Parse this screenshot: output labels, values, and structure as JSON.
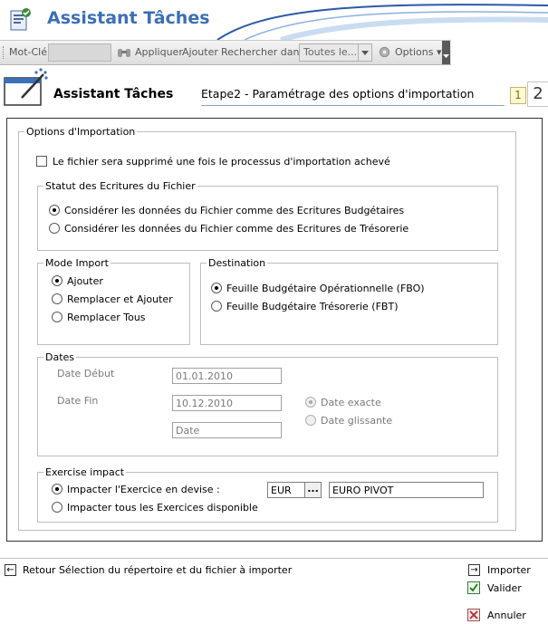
{
  "app": {
    "title": "Assistant Tâches"
  },
  "toolbar": {
    "keyword_label": "Mot-Clé",
    "apply_label": "Appliquer",
    "add_label": "Ajouter",
    "search_in_label": "Rechercher dans",
    "scope_value": "Toutes le...",
    "options_label": "Options"
  },
  "wizard": {
    "title": "Assistant Tâches",
    "step_title": "Etape2 - Paramétrage des options d'importation",
    "step1": "1",
    "step2": "2"
  },
  "import_options": {
    "legend": "Options d'Importation",
    "delete_file_label": "Le fichier sera supprimé une fois le processus d'importation achevé",
    "delete_file_checked": false
  },
  "statut": {
    "legend": "Statut des Ecritures du Fichier",
    "options": [
      "Considérer les données du Fichier comme des Ecritures Budgétaires",
      "Considérer les données du Fichier comme des Ecritures de Trésorerie"
    ],
    "selected_index": 0
  },
  "mode_import": {
    "legend": "Mode Import",
    "options": [
      "Ajouter",
      "Remplacer et Ajouter",
      "Remplacer Tous"
    ],
    "selected_index": 0
  },
  "destination": {
    "legend": "Destination",
    "options": [
      "Feuille Budgétaire Opérationnelle (FBO)",
      "Feuille Budgétaire Trésorerie (FBT)"
    ],
    "selected_index": 0
  },
  "dates": {
    "legend": "Dates",
    "start_label": "Date Début",
    "start_value": "01.01.2010",
    "end_label": "Date Fin",
    "end_value": "10.12.2010",
    "third_value": "Date",
    "exact_label": "Date exacte",
    "sliding_label": "Date glissante",
    "selected": "exact"
  },
  "exercise": {
    "legend": "Exercise impact",
    "option1": "Impacter l'Exercice en devise :",
    "option2": "Impacter tous les Exercices disponible",
    "selected_index": 0,
    "currency_code": "EUR",
    "currency_name": "EURO PIVOT",
    "ellipsis": "..."
  },
  "footer": {
    "back_label": "Retour Sélection du répertoire et du fichier à importer",
    "back_arrow": "←",
    "import_label": "Importer",
    "import_arrow": "→",
    "validate_label": "Valider",
    "cancel_label": "Annuler"
  },
  "colors": {
    "title_blue": "#3b6fb6",
    "toolbar_bg": "#e6e6e6",
    "step_line": "#8aa2c8"
  }
}
